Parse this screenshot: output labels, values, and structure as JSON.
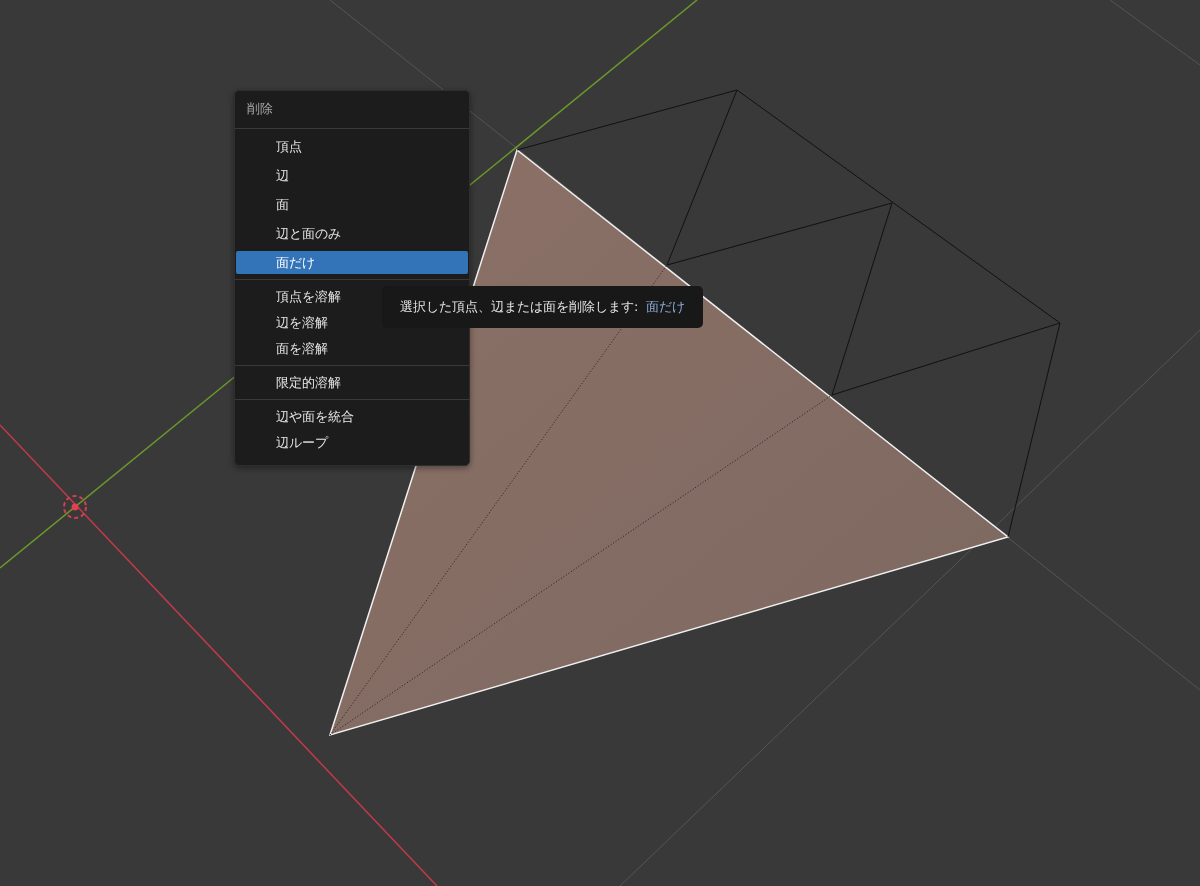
{
  "menu": {
    "title": "削除",
    "sections": [
      [
        {
          "label": "頂点",
          "selected": false
        },
        {
          "label": "辺",
          "selected": false
        },
        {
          "label": "面",
          "selected": false
        },
        {
          "label": "辺と面のみ",
          "selected": false
        },
        {
          "label": "面だけ",
          "selected": true
        }
      ],
      [
        {
          "label": "頂点を溶解",
          "selected": false
        },
        {
          "label": "辺を溶解",
          "selected": false
        },
        {
          "label": "面を溶解",
          "selected": false
        }
      ],
      [
        {
          "label": "限定的溶解",
          "selected": false
        }
      ],
      [
        {
          "label": "辺や面を統合",
          "selected": false
        },
        {
          "label": "辺ループ",
          "selected": false
        }
      ]
    ]
  },
  "tooltip": {
    "description": "選択した頂点、辺または面を削除します:",
    "value": "面だけ"
  }
}
